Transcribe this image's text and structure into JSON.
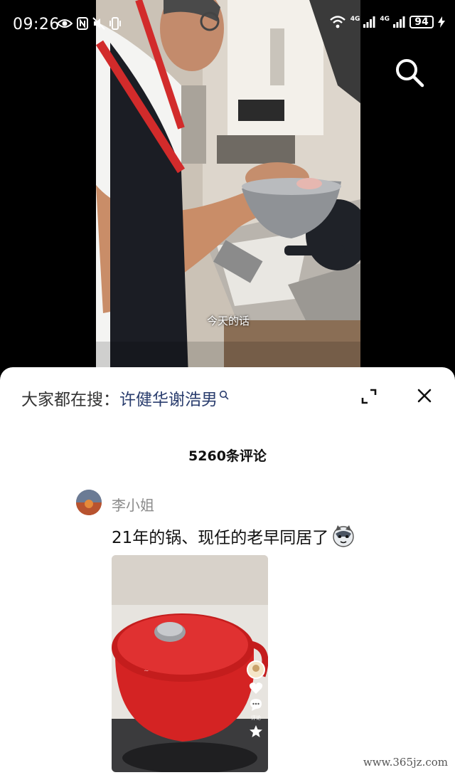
{
  "status_bar": {
    "time": "09:26",
    "battery": "94",
    "network_1": "4G",
    "network_2": "4G"
  },
  "video": {
    "caption": "今天的话"
  },
  "sheet": {
    "hot_search_prefix": "大家都在搜：",
    "hot_search_term": "许健华谢浩男",
    "comment_count_label": "5260条评论"
  },
  "comment": {
    "author": "李小姐",
    "text": "21年的锅、现任的老早同居了",
    "image_side_labels": [
      "评论"
    ]
  },
  "watermark": "www.365jz.com",
  "icons": {
    "search": "search-icon",
    "expand": "expand-icon",
    "close": "close-icon",
    "hot_search_small": "search-icon"
  },
  "colors": {
    "sheet_bg": "#ffffff",
    "hot_search_link": "#2a3d6e",
    "pot_red": "#d42323"
  }
}
